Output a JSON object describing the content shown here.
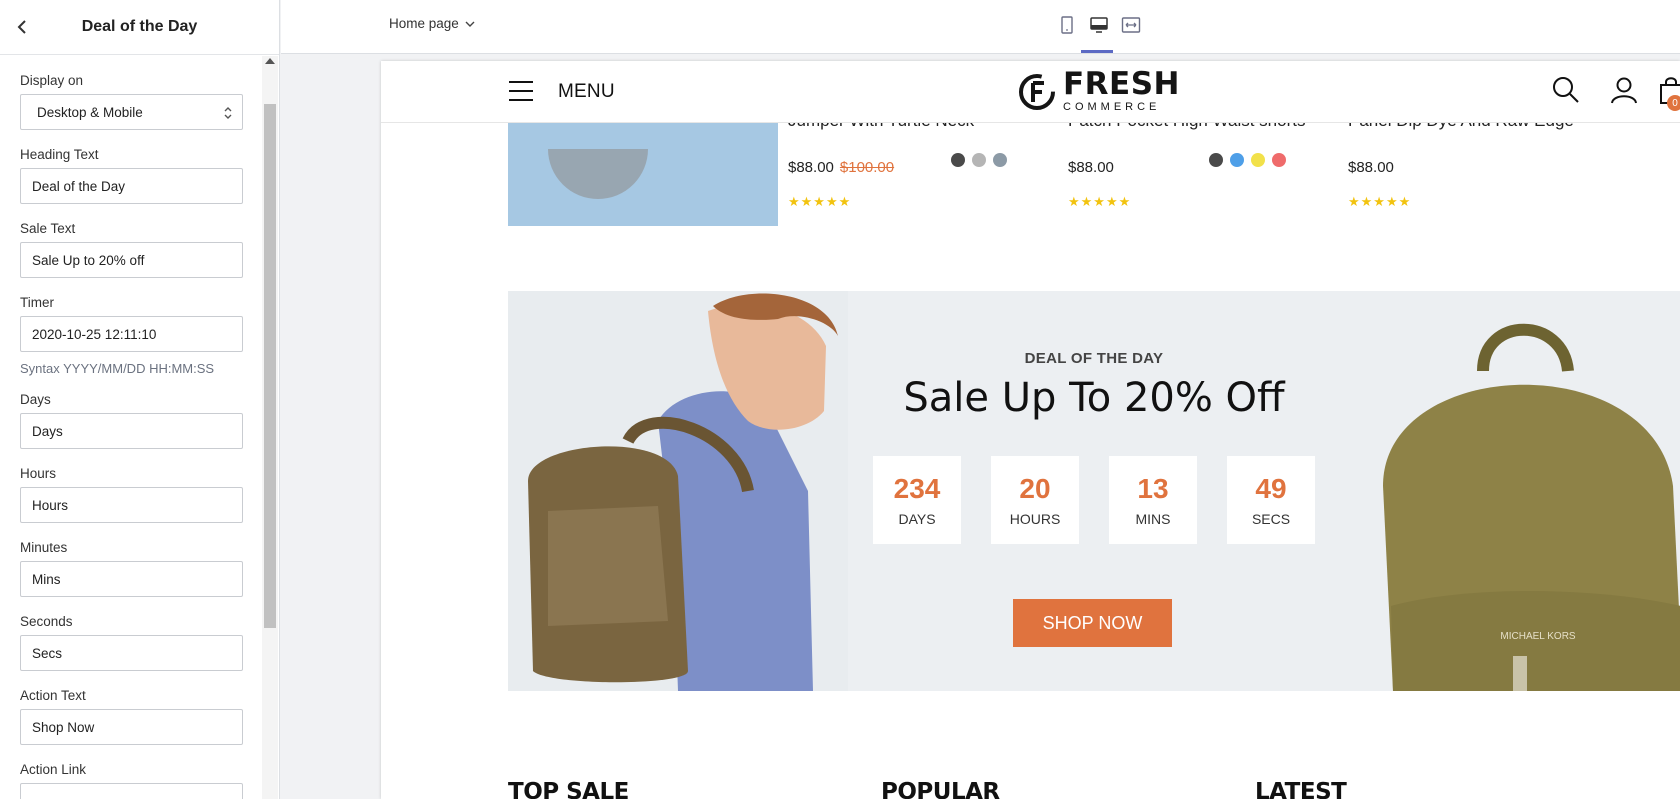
{
  "panel": {
    "title": "Deal of the Day",
    "fields": {
      "display_on": {
        "label": "Display on",
        "value": "Desktop & Mobile"
      },
      "heading_text": {
        "label": "Heading Text",
        "value": "Deal of the Day"
      },
      "sale_text": {
        "label": "Sale Text",
        "value": "Sale Up to 20% off"
      },
      "timer": {
        "label": "Timer",
        "value": "2020-10-25 12:11:10",
        "hint": "Syntax YYYY/MM/DD HH:MM:SS"
      },
      "days": {
        "label": "Days",
        "value": "Days"
      },
      "hours": {
        "label": "Hours",
        "value": "Hours"
      },
      "minutes": {
        "label": "Minutes",
        "value": "Mins"
      },
      "seconds": {
        "label": "Seconds",
        "value": "Secs"
      },
      "action_text": {
        "label": "Action Text",
        "value": "Shop Now"
      },
      "action_link": {
        "label": "Action Link",
        "value": ""
      }
    }
  },
  "toolbar": {
    "page_select": "Home page",
    "devices": [
      "mobile-icon",
      "desktop-icon",
      "fullwidth-icon"
    ],
    "active_device": "desktop-icon"
  },
  "store": {
    "menu_label": "MENU",
    "logo_main": "FRESH",
    "logo_sub": "COMMERCE",
    "cart_count": "0",
    "products": [
      {
        "name": "Jumper With Turtle Neck",
        "price": "$88.00",
        "old_price": "$100.00",
        "swatches": [
          "#4a4a4a",
          "#b5b5b5",
          "#8c9aa6"
        ]
      },
      {
        "name": "Patch Pocket High Waist shorts",
        "price": "$88.00",
        "old_price": "",
        "swatches": [
          "#4a4a4a",
          "#4e9fe8",
          "#f2e14a",
          "#ef6b6b"
        ]
      },
      {
        "name": "Panel Dip Dye And Raw Edge",
        "price": "$88.00",
        "old_price": "",
        "swatches": []
      }
    ],
    "rating_stars": "★★★★★",
    "deal": {
      "kicker": "DEAL OF THE DAY",
      "title": "Sale Up To 20% Off",
      "timer": [
        {
          "num": "234",
          "label": "DAYS"
        },
        {
          "num": "20",
          "label": "HOURS"
        },
        {
          "num": "13",
          "label": "MINS"
        },
        {
          "num": "49",
          "label": "SECS"
        }
      ],
      "button": "SHOP NOW",
      "bag_brand": "MICHAEL KORS"
    },
    "sections": [
      "TOP SALE",
      "POPULAR",
      "LATEST"
    ]
  },
  "colors": {
    "accent": "#e0733e",
    "active_device": "#5c6ac4",
    "stars": "#f2c30f"
  }
}
